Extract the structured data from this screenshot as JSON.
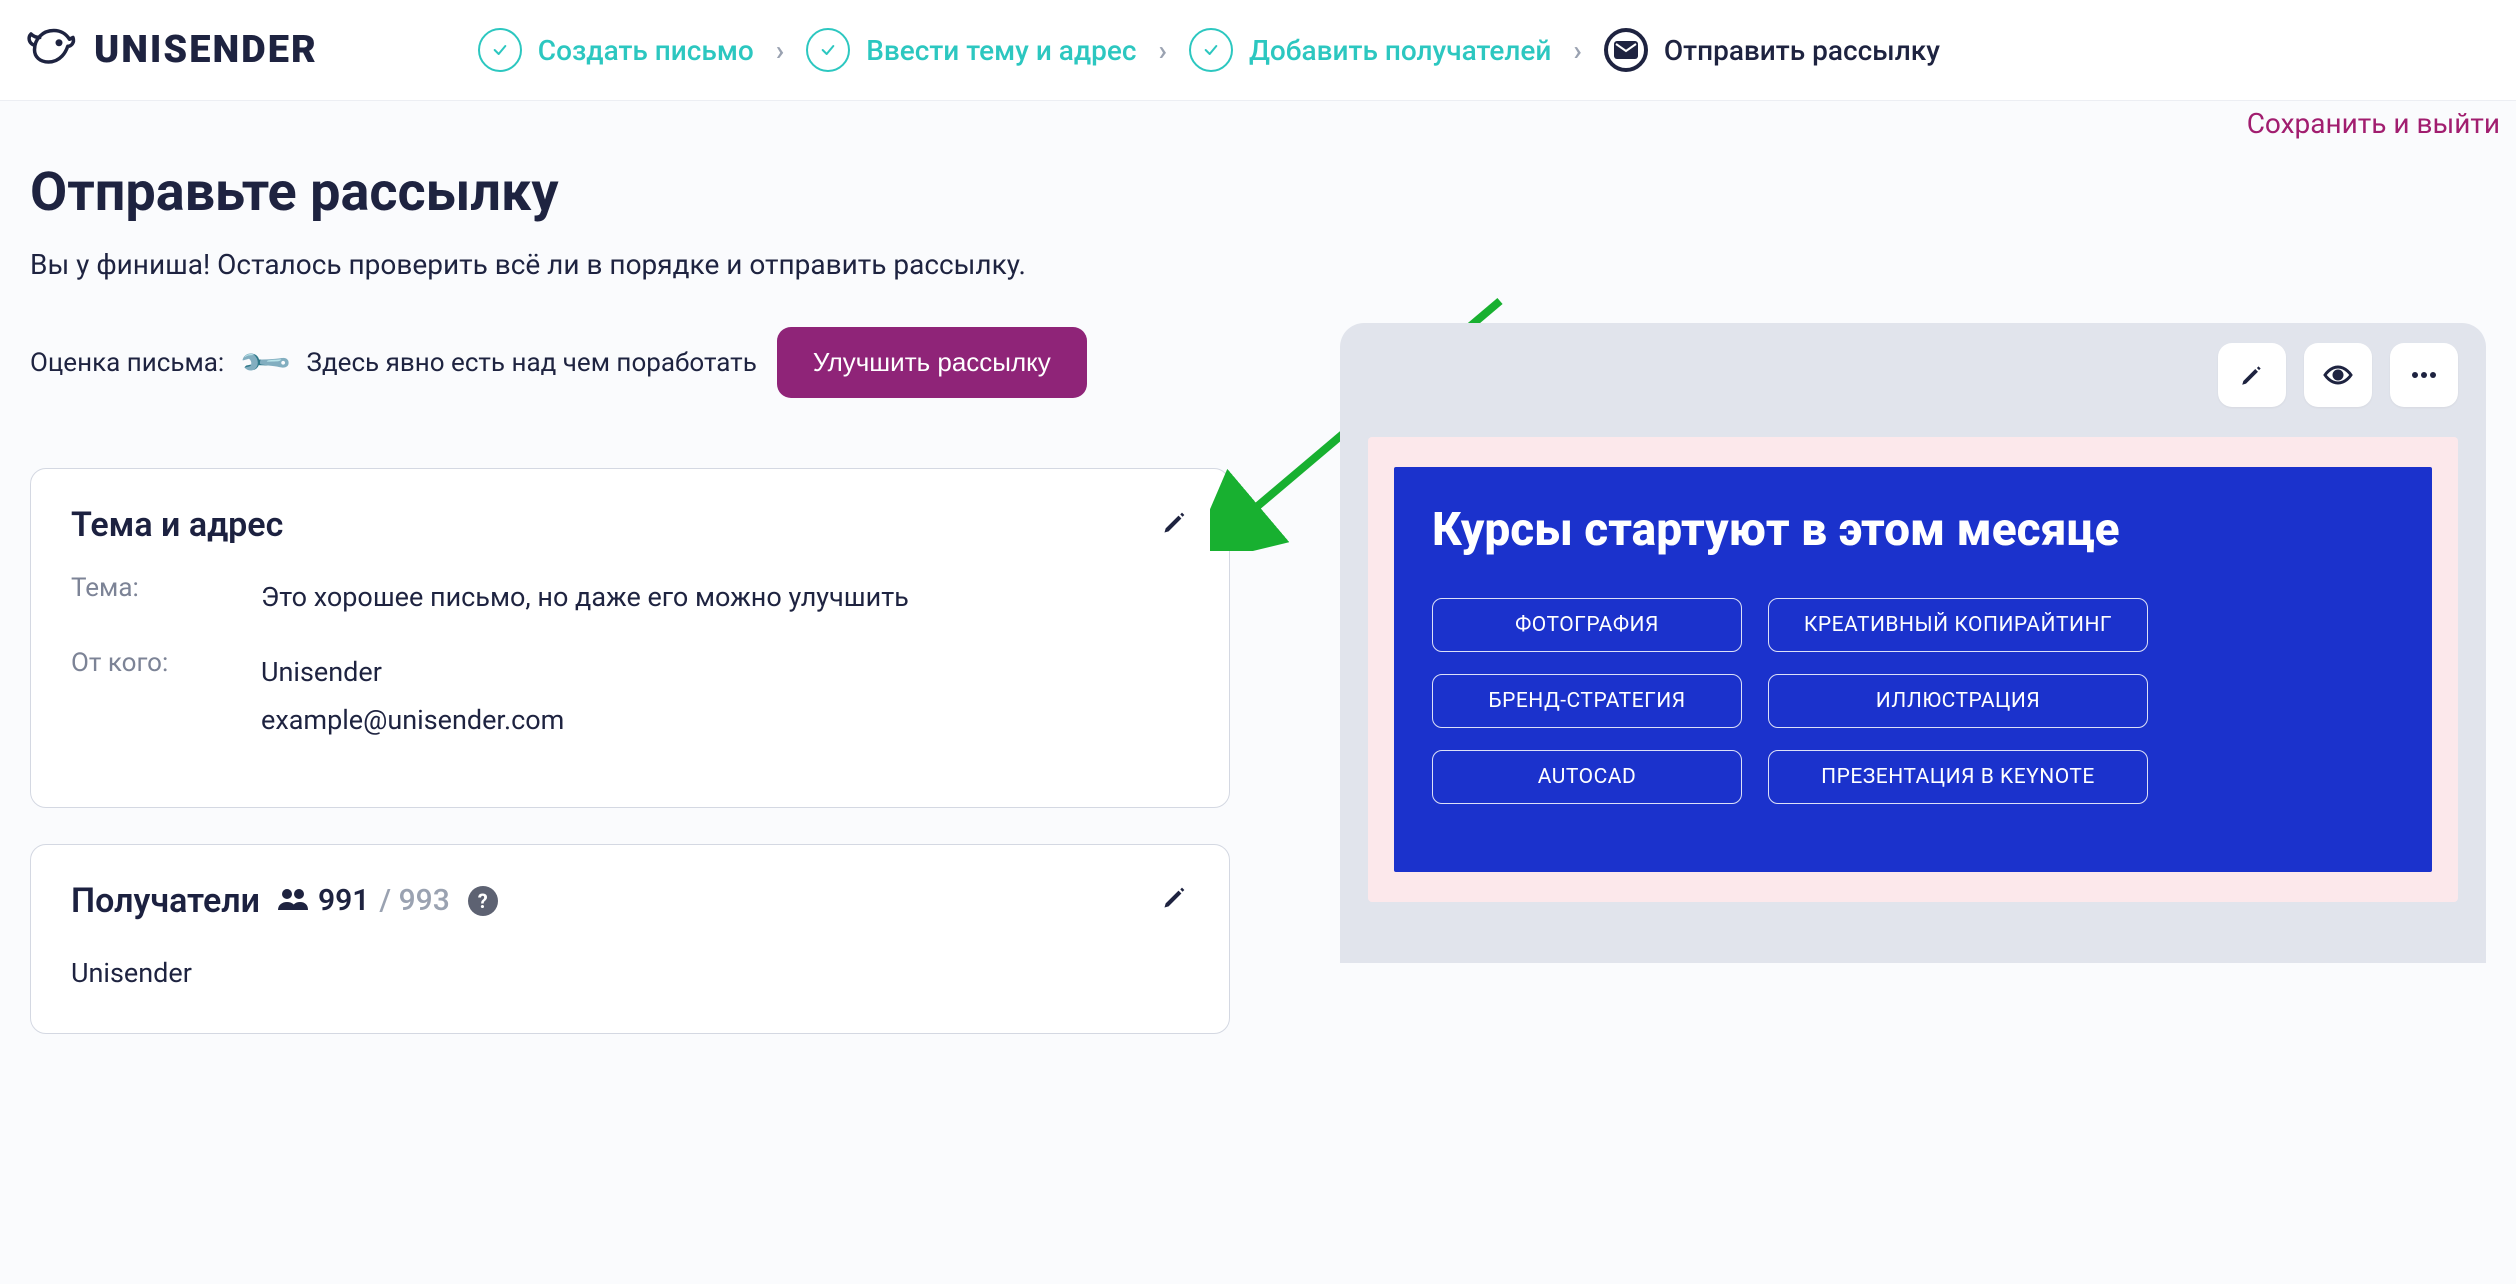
{
  "header": {
    "logo_text": "UNISENDER",
    "steps": [
      {
        "label": "Создать письмо",
        "state": "done"
      },
      {
        "label": "Ввести тему и адрес",
        "state": "done"
      },
      {
        "label": "Добавить получателей",
        "state": "done"
      },
      {
        "label": "Отправить рассылку",
        "state": "current"
      }
    ]
  },
  "main": {
    "title": "Отправьте рассылку",
    "subtitle": "Вы у финиша! Осталось проверить всё ли в порядке и отправить рассылку.",
    "save_exit": "Сохранить и выйти",
    "rating": {
      "label": "Оценка письма:",
      "text": "Здесь явно есть над чем поработать",
      "button": "Улучшить рассылку"
    },
    "card_subject": {
      "title": "Тема и адрес",
      "rows": {
        "subject_label": "Тема:",
        "subject_value": "Это хорошее письмо, но даже его можно улучшить",
        "from_label": "От кого:",
        "from_name": "Unisender",
        "from_email": "example@unisender.com"
      }
    },
    "card_recipients": {
      "title": "Получатели",
      "active": "991",
      "total": "993",
      "list_name": "Unisender"
    },
    "preview": {
      "hero_title": "Курсы стартуют в этом месяце",
      "pills_row1_a": "ФОТОГРАФИЯ",
      "pills_row1_b": "КРЕАТИВНЫЙ КОПИРАЙТИНГ",
      "pills_row2_a": "БРЕНД-СТРАТЕГИЯ",
      "pills_row2_b": "ИЛЛЮСТРАЦИЯ",
      "pills_row3_a": "AUTOCAD",
      "pills_row3_b": "ПРЕЗЕНТАЦИЯ В KEYNOTE"
    }
  }
}
